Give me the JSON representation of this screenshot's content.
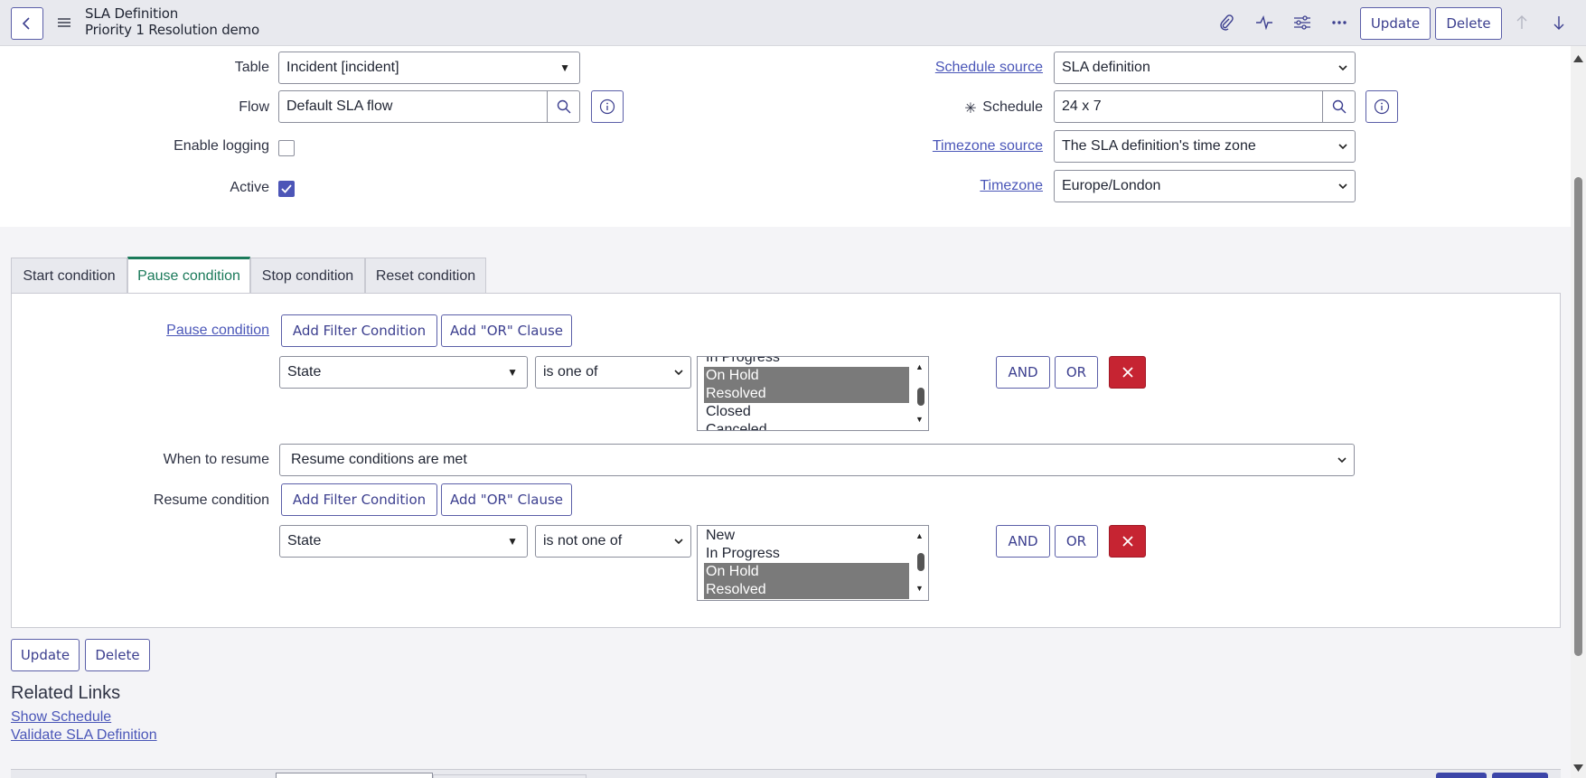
{
  "header": {
    "record_type": "SLA Definition",
    "record_name": "Priority 1 Resolution demo",
    "update_label": "Update",
    "delete_label": "Delete"
  },
  "form": {
    "table_label": "Table",
    "table_value": "Incident [incident]",
    "flow_label": "Flow",
    "flow_value": "Default SLA flow",
    "enable_logging_label": "Enable logging",
    "enable_logging_checked": false,
    "active_label": "Active",
    "active_checked": true,
    "schedule_source_label": "Schedule source",
    "schedule_source_value": "SLA definition",
    "schedule_required_mark": "✳",
    "schedule_label": "Schedule",
    "schedule_value": "24 x 7",
    "timezone_source_label": "Timezone source",
    "timezone_source_value": "The SLA definition's time zone",
    "timezone_label": "Timezone",
    "timezone_value": "Europe/London"
  },
  "tabs": [
    {
      "label": "Start condition",
      "active": false
    },
    {
      "label": "Pause condition",
      "active": true
    },
    {
      "label": "Stop condition",
      "active": false
    },
    {
      "label": "Reset condition",
      "active": false
    }
  ],
  "pause": {
    "label": "Pause condition",
    "add_filter_label": "Add Filter Condition",
    "add_or_label": "Add \"OR\" Clause",
    "field_value": "State",
    "operator_value": "is one of",
    "options": [
      {
        "label": "In Progress",
        "selected": false
      },
      {
        "label": "On Hold",
        "selected": true
      },
      {
        "label": "Resolved",
        "selected": true
      },
      {
        "label": "Closed",
        "selected": false
      },
      {
        "label": "Canceled",
        "selected": false
      }
    ],
    "and_label": "AND",
    "or_label": "OR"
  },
  "resume": {
    "when_label": "When to resume",
    "when_value": "Resume conditions are met",
    "label": "Resume condition",
    "add_filter_label": "Add Filter Condition",
    "add_or_label": "Add \"OR\" Clause",
    "field_value": "State",
    "operator_value": "is not one of",
    "options": [
      {
        "label": "New",
        "selected": false
      },
      {
        "label": "In Progress",
        "selected": false
      },
      {
        "label": "On Hold",
        "selected": true
      },
      {
        "label": "Resolved",
        "selected": true
      }
    ],
    "and_label": "AND",
    "or_label": "OR"
  },
  "footer": {
    "update_label": "Update",
    "delete_label": "Delete",
    "related_links_title": "Related Links",
    "links": [
      "Show Schedule",
      "Validate SLA Definition"
    ]
  },
  "colors": {
    "accent": "#3c3f8f",
    "active_tab": "#1b7a5a",
    "delete_red": "#c62432",
    "selected_option": "#7a7a7a"
  }
}
